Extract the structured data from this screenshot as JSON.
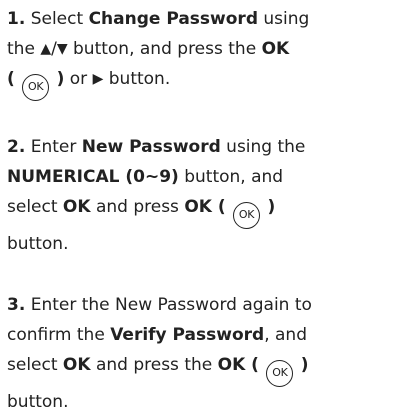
{
  "steps": [
    {
      "number": "1.",
      "l1_a": " Select ",
      "l1_b": "Change Password",
      "l1_c": " using",
      "l2_a": "the ",
      "l2_up": "▲",
      "l2_slash": "/",
      "l2_down": "▼",
      "l2_b": " button, and press the ",
      "l2_c": "OK",
      "l3_open": "(",
      "l3_icon": "OK",
      "l3_close": ")",
      "l3_or": " or ",
      "l3_right": "▶",
      "l3_end": " button."
    },
    {
      "number": "2.",
      "l1_a": " Enter ",
      "l1_b": "New Password",
      "l1_c": " using the",
      "l2_a": "NUMERICAL (0~9)",
      "l2_b": " button, and",
      "l3_a": "select ",
      "l3_b": "OK",
      "l3_c": " and press ",
      "l3_d": "OK (",
      "l3_icon": "OK",
      "l3_e": ")",
      "l4_a": "button."
    },
    {
      "number": "3.",
      "l1_a": " Enter the New Password again to",
      "l2_a": "confirm the ",
      "l2_b": "Verify Password",
      "l2_c": ", and",
      "l3_a": "select ",
      "l3_b": "OK",
      "l3_c": " and press the ",
      "l3_d": "OK (",
      "l3_icon": "OK",
      "l3_e": ")",
      "l4_a": "button."
    }
  ]
}
